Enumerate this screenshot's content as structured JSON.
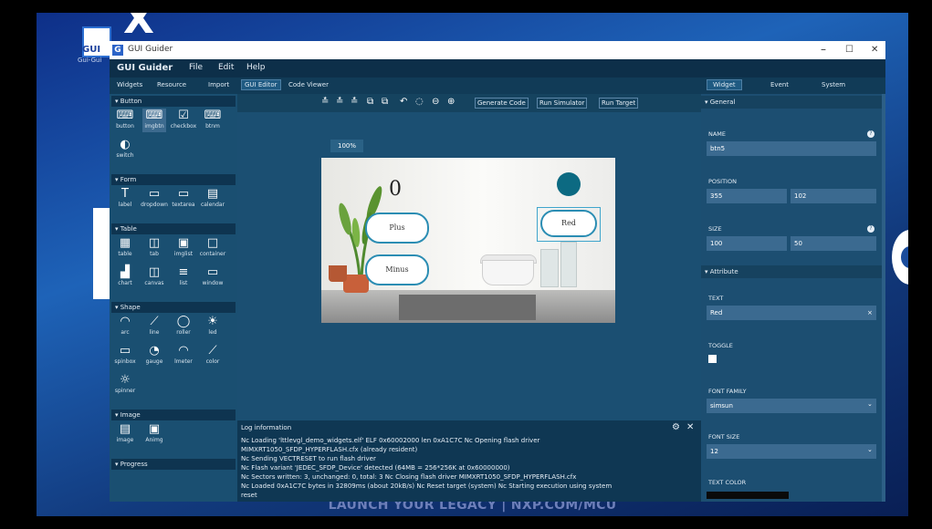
{
  "window": {
    "title": "GUI Guider",
    "minimize": "–",
    "maximize": "☐",
    "close": "✕"
  },
  "desktop": {
    "icon_label": "GUI",
    "icon_sub": "Gui-Gui",
    "banner": "LAUNCH YOUR LEGACY | NXP.COM/MCU"
  },
  "menu": {
    "brand": "GUI Guider",
    "items": [
      "File",
      "Edit",
      "Help"
    ]
  },
  "left": {
    "tabs": [
      "Widgets",
      "Resource",
      "Import"
    ],
    "sections": {
      "button": "▾ Button",
      "form": "▾ Form",
      "table": "▾ Table",
      "shape": "▾ Shape",
      "image": "▾ Image",
      "progress": "▾ Progress"
    },
    "button_widgets": [
      {
        "label": "button",
        "icon": "⌨"
      },
      {
        "label": "imgbtn",
        "icon": "⌨"
      },
      {
        "label": "checkbox",
        "icon": "☑"
      },
      {
        "label": "btnm",
        "icon": "⌨"
      },
      {
        "label": "switch",
        "icon": "◐"
      }
    ],
    "form_widgets": [
      {
        "label": "label",
        "icon": "T"
      },
      {
        "label": "dropdown",
        "icon": "▭"
      },
      {
        "label": "textarea",
        "icon": "▭"
      },
      {
        "label": "calendar",
        "icon": "▤"
      }
    ],
    "table_widgets": [
      {
        "label": "table",
        "icon": "▦"
      },
      {
        "label": "tab",
        "icon": "◫"
      },
      {
        "label": "imglist",
        "icon": "▣"
      },
      {
        "label": "container",
        "icon": "□"
      },
      {
        "label": "chart",
        "icon": "▟"
      },
      {
        "label": "canvas",
        "icon": "◫"
      },
      {
        "label": "list",
        "icon": "≡"
      },
      {
        "label": "window",
        "icon": "▭"
      }
    ],
    "shape_widgets": [
      {
        "label": "arc",
        "icon": "◠"
      },
      {
        "label": "line",
        "icon": "⟋"
      },
      {
        "label": "roller",
        "icon": "◯"
      },
      {
        "label": "led",
        "icon": "☀"
      },
      {
        "label": "spinbox",
        "icon": "▭"
      },
      {
        "label": "gauge",
        "icon": "◔"
      },
      {
        "label": "lmeter",
        "icon": "◠"
      },
      {
        "label": "color",
        "icon": "⟋"
      },
      {
        "label": "spinner",
        "icon": "☼"
      }
    ],
    "image_widgets": [
      {
        "label": "image",
        "icon": "▤"
      },
      {
        "label": "Animg",
        "icon": "▣"
      }
    ]
  },
  "center": {
    "tabs": [
      "GUI Editor",
      "Code Viewer"
    ],
    "toolbar_icons": [
      "≛",
      "≛",
      "≛",
      "⧉",
      "⧉",
      "↶",
      "◌",
      "⊖",
      "⊕"
    ],
    "buttons": {
      "generate": "Generate Code",
      "simulator": "Run Simulator",
      "target": "Run Target"
    },
    "zoom": "100%",
    "screen": {
      "counter": "0",
      "btn_plus": "Plus",
      "btn_minus": "Minus",
      "btn_red": "Red",
      "led_color": "#0c6a82"
    },
    "log": {
      "title": "Log information",
      "lines": [
        "Nc Loading 'lttlevgl_demo_widgets.elf' ELF 0x60002000 len 0xA1C7C Nc Opening flash driver",
        "MIMXRT1050_SFDP_HYPERFLASH.cfx (already resident)",
        "Nc Sending VECTRESET to run flash driver",
        "Nc Flash variant 'JEDEC_SFDP_Device' detected (64MB = 256*256K at 0x60000000)",
        "Nc Sectors written: 3, unchanged: 0, total: 3 Nc Closing flash driver MIMXRT1050_SFDP_HYPERFLASH.cfx",
        "Nc Loaded 0xA1C7C bytes in 32809ms (about 20kB/s) Nc Reset target (system) Nc Starting execution using system",
        "reset"
      ]
    }
  },
  "right": {
    "tabs": [
      "Widget",
      "Event",
      "System"
    ],
    "sections": {
      "general": "▾ General",
      "attribute": "▾ Attribute"
    },
    "name_label": "NAME",
    "name_value": "btn5",
    "position_label": "POSITION",
    "pos_x": "355",
    "pos_y": "102",
    "size_label": "SIZE",
    "width": "100",
    "height": "50",
    "text_label": "TEXT",
    "text_value": "Red",
    "text_clear": "×",
    "toggle_label": "TOGGLE",
    "font_family_label": "FONT FAMILY",
    "font_family_value": "simsun",
    "font_size_label": "FONT SIZE",
    "font_size_value": "12",
    "text_color_label": "TEXT COLOR",
    "help_icon": "?",
    "dropdown_arrow": "⌄"
  }
}
